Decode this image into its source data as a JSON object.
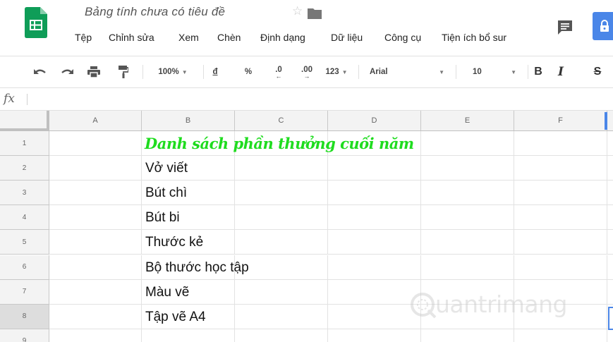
{
  "doc": {
    "title": "Bảng tính chưa có tiêu đề"
  },
  "menu": [
    "Tệp",
    "Chỉnh sửa",
    "Xem",
    "Chèn",
    "Định dạng",
    "Dữ liệu",
    "Công cụ",
    "Tiện ích bổ sur"
  ],
  "toolbar": {
    "zoom": "100%",
    "currency": "đ",
    "percent": "%",
    "decrease_decimals": ".0",
    "increase_decimals": ".00",
    "more_formats": "123",
    "font": "Arial",
    "font_size": "10",
    "bold": "B",
    "italic": "I",
    "strikethrough": "S"
  },
  "formula_bar": {
    "icon": "fx",
    "value": ""
  },
  "columns": [
    "A",
    "B",
    "C",
    "D",
    "E",
    "F"
  ],
  "rows": [
    {
      "num": "1",
      "text": "Danh sách phần thưởng cuối năm"
    },
    {
      "num": "2",
      "text": "Vở viết"
    },
    {
      "num": "3",
      "text": "Bút chì"
    },
    {
      "num": "4",
      "text": "Bút bi"
    },
    {
      "num": "5",
      "text": "Thước kẻ"
    },
    {
      "num": "6",
      "text": "Bộ thước học tập"
    },
    {
      "num": "7",
      "text": "Màu vẽ"
    },
    {
      "num": "8",
      "text": "Tập vẽ A4"
    },
    {
      "num": "9",
      "text": ""
    }
  ],
  "watermark": {
    "text": "uantrimang"
  },
  "colors": {
    "brand_green": "#0f9d58",
    "accent_blue": "#4a86e8",
    "title_green": "#1fdc1f"
  },
  "icons": [
    "sheets-logo-icon",
    "star-icon",
    "folder-icon",
    "comment-icon",
    "lock-icon",
    "undo-icon",
    "redo-icon",
    "print-icon",
    "paint-format-icon",
    "caret-down-icon"
  ]
}
